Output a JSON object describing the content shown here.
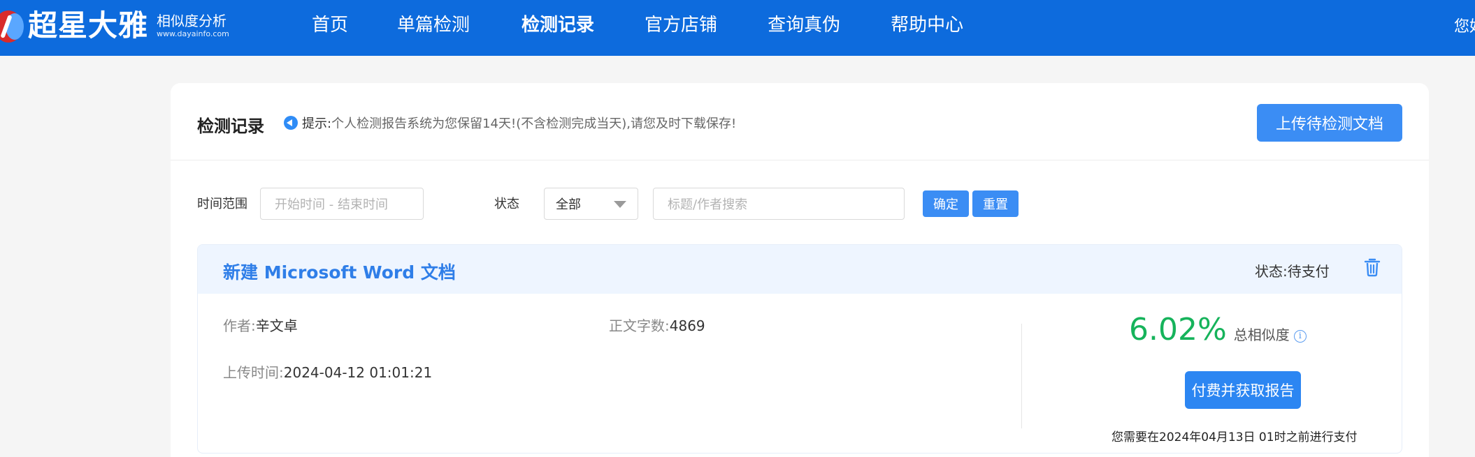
{
  "brand": {
    "name": "超星大雅",
    "subtitle": "相似度分析",
    "url": "www.dayainfo.com"
  },
  "nav": {
    "items": [
      {
        "label": "首页"
      },
      {
        "label": "单篇检测"
      },
      {
        "label": "检测记录",
        "active": true
      },
      {
        "label": "官方店铺"
      },
      {
        "label": "查询真伪"
      },
      {
        "label": "帮助中心"
      }
    ],
    "user_greeting": "您好"
  },
  "page": {
    "title": "检测记录",
    "tip_label": "提示:",
    "tip_text": "个人检测报告系统为您保留14天!(不含检测完成当天),请您及时下载保存!",
    "upload_button": "上传待检测文档"
  },
  "filters": {
    "time_label": "时间范围",
    "time_placeholder": "开始时间 - 结束时间",
    "status_label": "状态",
    "status_selected": "全部",
    "search_placeholder": "标题/作者搜索",
    "confirm_button": "确定",
    "reset_button": "重置"
  },
  "record": {
    "title": "新建 Microsoft Word 文档",
    "status_text": "状态:待支付",
    "author_label": "作者:",
    "author": "辛文卓",
    "wordcount_label": "正文字数:",
    "wordcount": "4869",
    "upload_time_label": "上传时间:",
    "upload_time": "2024-04-12 01:01:21",
    "similarity": "6.02%",
    "similarity_label": "总相似度",
    "info_icon": "i",
    "pay_button": "付费并获取报告",
    "pay_note": "您需要在2024年04月13日 01时之前进行支付"
  },
  "colors": {
    "topbar": "#0d6bdd",
    "primary_button": "#3b8df4",
    "similarity_green": "#16b35b",
    "record_title_blue": "#2f7ee8",
    "record_head_bg": "#eef5ff"
  }
}
